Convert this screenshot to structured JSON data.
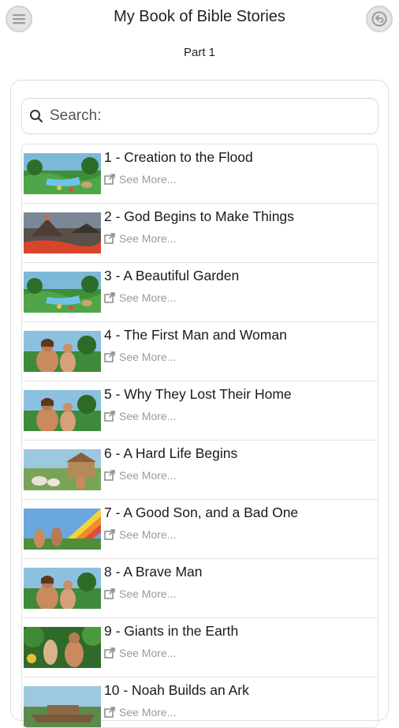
{
  "header": {
    "title": "My Book of Bible Stories",
    "subtitle": "Part 1",
    "menu_icon": "hamburger-menu-icon",
    "back_icon": "back-arrow-icon"
  },
  "search": {
    "label": "Search:",
    "icon": "search-icon"
  },
  "items": [
    {
      "title": "1 - Creation to the Flood",
      "link": "See More...",
      "thumb": "garden-scene"
    },
    {
      "title": "2 - God Begins to Make Things",
      "link": "See More...",
      "thumb": "volcano-scene"
    },
    {
      "title": "3 - A Beautiful Garden",
      "link": "See More...",
      "thumb": "garden-scene"
    },
    {
      "title": "4 - The First Man and Woman",
      "link": "See More...",
      "thumb": "people-scene"
    },
    {
      "title": "5 - Why They Lost Their Home",
      "link": "See More...",
      "thumb": "people-scene"
    },
    {
      "title": "6 - A Hard Life Begins",
      "link": "See More...",
      "thumb": "village-scene"
    },
    {
      "title": "7 - A Good Son, and a Bad One",
      "link": "See More...",
      "thumb": "rainbow-scene"
    },
    {
      "title": "8 - A Brave Man",
      "link": "See More...",
      "thumb": "people-scene"
    },
    {
      "title": "9 - Giants in the Earth",
      "link": "See More...",
      "thumb": "jungle-scene"
    },
    {
      "title": "10 - Noah Builds an Ark",
      "link": "See More...",
      "thumb": "ark-scene"
    }
  ],
  "colors": {
    "link_gray": "#9a9a9a",
    "button_gray": "#e4e4e4"
  }
}
